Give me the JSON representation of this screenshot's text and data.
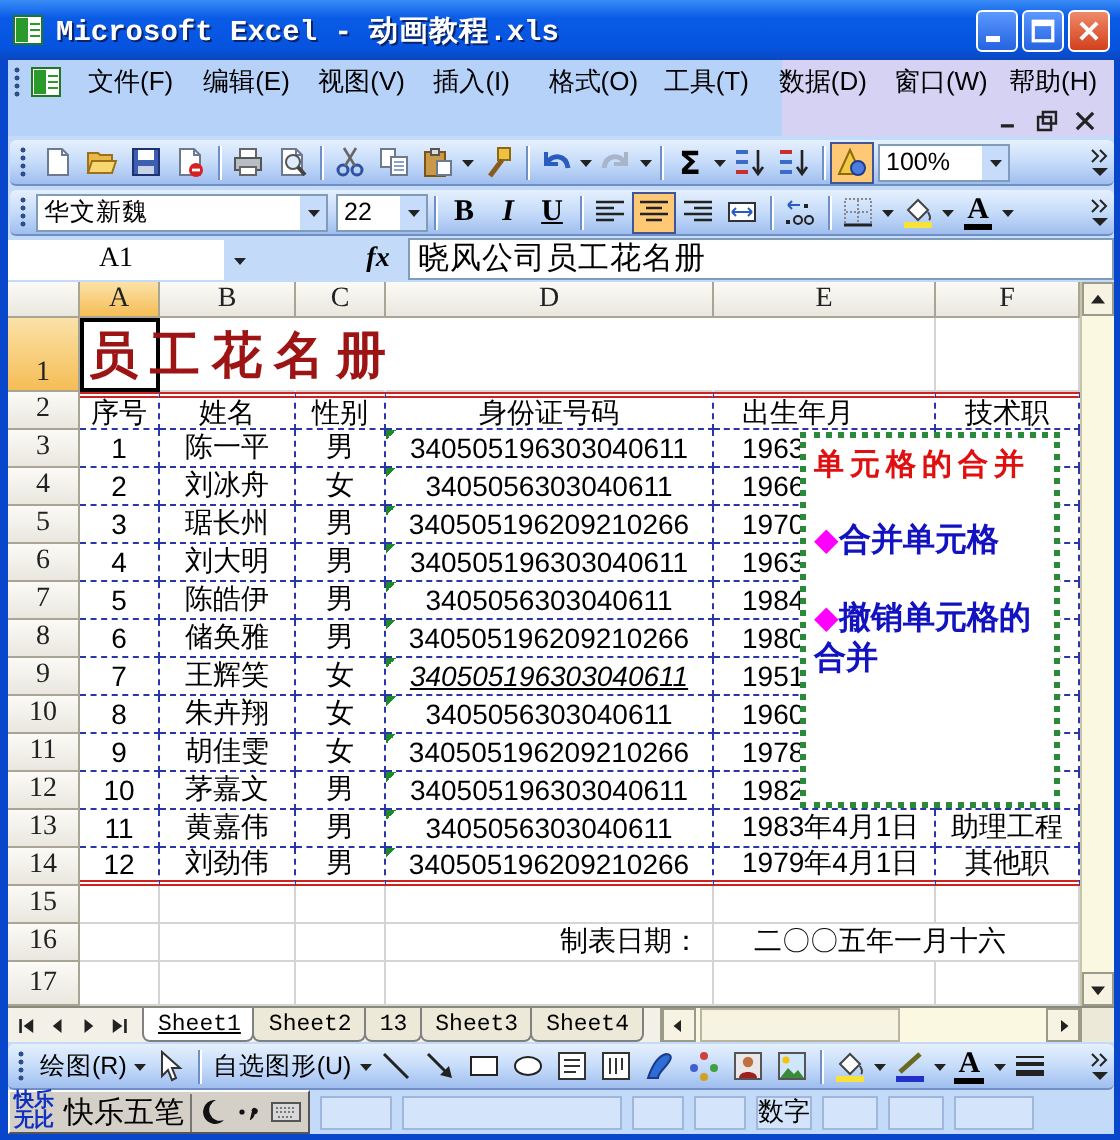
{
  "window": {
    "title": "Microsoft Excel - 动画教程.xls"
  },
  "menu": [
    "文件(F)",
    "编辑(E)",
    "视图(V)",
    "插入(I)",
    "格式(O)",
    "工具(T)",
    "数据(D)",
    "窗口(W)",
    "帮助(H)"
  ],
  "standard_toolbar": {
    "sum": "Σ",
    "drawing_toggle": {
      "selected": true
    },
    "zoom": "100%"
  },
  "format_toolbar": {
    "font": "华文新魏",
    "size": "22",
    "styles": [
      {
        "label": "B",
        "selected": false
      },
      {
        "label": "I",
        "selected": false
      },
      {
        "label": "U",
        "selected": false
      }
    ],
    "align": [
      {
        "selected": false
      },
      {
        "selected": true
      },
      {
        "selected": false
      }
    ],
    "font_color": "A"
  },
  "formula_bar": {
    "name_box": "A1",
    "fx": "fx",
    "formula": "晓风公司员工花名册"
  },
  "grid": {
    "columns": [
      {
        "label": "A",
        "selected": true
      },
      {
        "label": "B",
        "selected": false
      },
      {
        "label": "C",
        "selected": false
      },
      {
        "label": "D",
        "selected": false
      },
      {
        "label": "E",
        "selected": false
      },
      {
        "label": "F",
        "selected": false
      }
    ],
    "rows": [
      {
        "kind": "title",
        "header": "1",
        "selected": true,
        "text": "员工花名册"
      },
      {
        "kind": "header",
        "header": "2",
        "selected": false,
        "cells": [
          "序号",
          "姓名",
          "性别",
          "身份证号码",
          "出生年月",
          "技术职"
        ]
      },
      {
        "kind": "data",
        "header": "3",
        "selected": false,
        "italic": false,
        "cells": [
          "1",
          "陈一平",
          "男",
          "340505196303040611",
          "1963"
        ]
      },
      {
        "kind": "data",
        "header": "4",
        "selected": false,
        "italic": false,
        "cells": [
          "2",
          "刘冰舟",
          "女",
          "3405056303040611",
          "1966"
        ]
      },
      {
        "kind": "data",
        "header": "5",
        "selected": false,
        "italic": false,
        "cells": [
          "3",
          "琚长州",
          "男",
          "340505196209210266",
          "1970"
        ]
      },
      {
        "kind": "data",
        "header": "6",
        "selected": false,
        "italic": false,
        "cells": [
          "4",
          "刘大明",
          "男",
          "340505196303040611",
          "1963"
        ]
      },
      {
        "kind": "data",
        "header": "7",
        "selected": false,
        "italic": false,
        "cells": [
          "5",
          "陈皓伊",
          "男",
          "3405056303040611",
          "1984"
        ]
      },
      {
        "kind": "data",
        "header": "8",
        "selected": false,
        "italic": false,
        "cells": [
          "6",
          "储奂雅",
          "男",
          "340505196209210266",
          "1980"
        ]
      },
      {
        "kind": "data",
        "header": "9",
        "selected": false,
        "italic": true,
        "cells": [
          "7",
          "王辉笑",
          "女",
          "340505196303040611",
          "1951"
        ]
      },
      {
        "kind": "data",
        "header": "10",
        "selected": false,
        "italic": false,
        "cells": [
          "8",
          "朱卉翔",
          "女",
          "3405056303040611",
          "1960"
        ]
      },
      {
        "kind": "data",
        "header": "11",
        "selected": false,
        "italic": false,
        "cells": [
          "9",
          "胡佳雯",
          "女",
          "340505196209210266",
          "1978"
        ]
      },
      {
        "kind": "data",
        "header": "12",
        "selected": false,
        "italic": false,
        "cells": [
          "10",
          "茅嘉文",
          "男",
          "340505196303040611",
          "1982"
        ]
      },
      {
        "kind": "data",
        "header": "13",
        "selected": false,
        "italic": false,
        "cells": [
          "11",
          "黄嘉伟",
          "男",
          "3405056303040611",
          "1983年4月1日",
          "助理工程"
        ]
      },
      {
        "kind": "data",
        "header": "14",
        "selected": false,
        "italic": false,
        "cells": [
          "12",
          "刘劲伟",
          "男",
          "340505196209210266",
          "1979年4月1日",
          "其他职"
        ]
      },
      {
        "kind": "blank",
        "header": "15",
        "selected": false
      },
      {
        "kind": "footer",
        "header": "16",
        "selected": false,
        "label": "制表日期：",
        "value": "二〇〇五年一月十六"
      },
      {
        "kind": "blank",
        "header": "17",
        "selected": false
      }
    ]
  },
  "comment": {
    "title": "单元格的合并",
    "items": [
      {
        "bullet": "◆",
        "text": "合并单元格"
      },
      {
        "bullet": "◆",
        "text": "撤销单元格的合并"
      }
    ]
  },
  "sheet_tabs": [
    {
      "label": "Sheet1",
      "selected": true
    },
    {
      "label": "Sheet2",
      "selected": false
    },
    {
      "label": "13",
      "selected": false
    },
    {
      "label": "Sheet3",
      "selected": false
    },
    {
      "label": "Sheet4",
      "selected": false
    }
  ],
  "drawing_toolbar": {
    "draw": "绘图(R)",
    "autoshapes": "自选图形(U)",
    "font_color": "A"
  },
  "status_bar": {
    "ime_logo": "快乐无比",
    "ime_name": "快乐五笔",
    "num_indicator": "数字"
  }
}
